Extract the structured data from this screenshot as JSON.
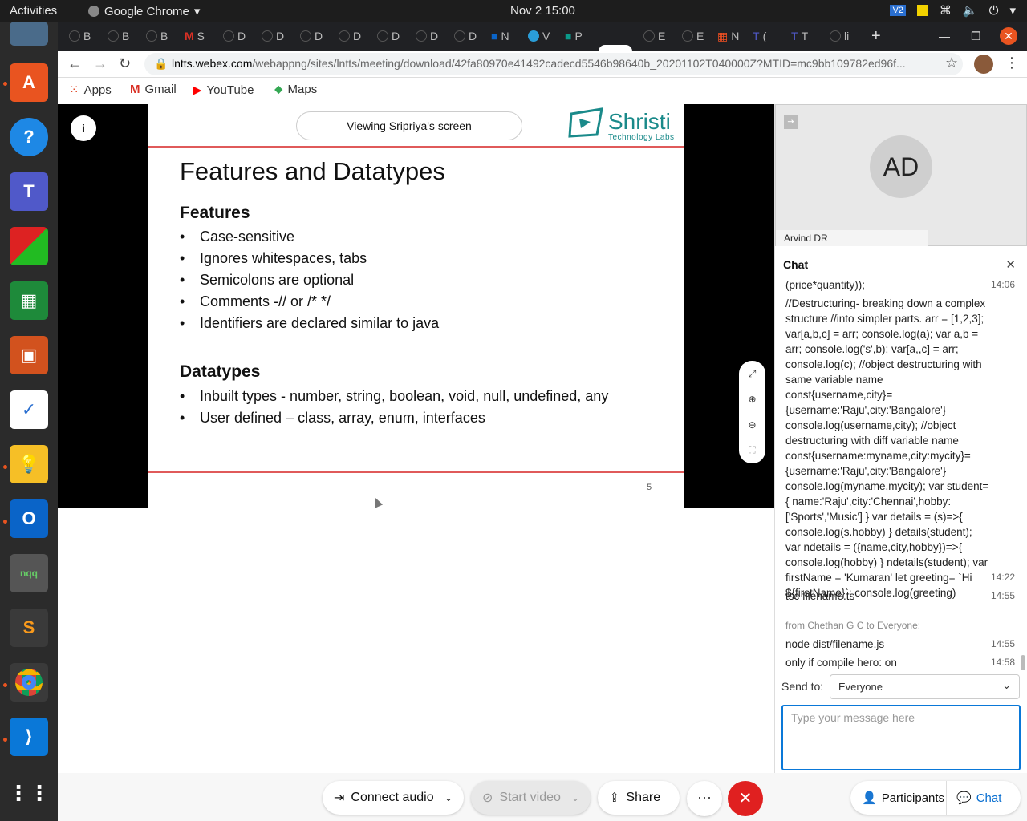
{
  "topbar": {
    "activities": "Activities",
    "app_name": "Google Chrome",
    "clock": "Nov 2  15:00",
    "tray_vd": "V2"
  },
  "dock": {
    "items": [
      "files-icon",
      "software-icon",
      "help-icon",
      "teams-icon",
      "office-icon",
      "calc-icon",
      "impress-icon",
      "todo-icon",
      "keep-icon",
      "outlook-icon",
      "notes-icon",
      "sublime-icon",
      "chrome-icon",
      "vscode-icon",
      "grid-icon"
    ]
  },
  "tabs": [
    {
      "label": "B"
    },
    {
      "label": "B"
    },
    {
      "label": "B"
    },
    {
      "label": "S"
    },
    {
      "label": "D"
    },
    {
      "label": "D"
    },
    {
      "label": "D"
    },
    {
      "label": "D"
    },
    {
      "label": "D"
    },
    {
      "label": "D"
    },
    {
      "label": "D"
    },
    {
      "label": "N"
    },
    {
      "label": "V"
    },
    {
      "label": "P"
    },
    {
      "label": ""
    },
    {
      "label": "E"
    },
    {
      "label": "E"
    },
    {
      "label": "N"
    },
    {
      "label": "("
    },
    {
      "label": "T"
    },
    {
      "label": "li"
    }
  ],
  "address": {
    "host": "lntts.webex.com",
    "path": "/webappng/sites/lntts/meeting/download/42fa80970e41492cadecd5546b98640b_20201102T040000Z?MTID=mc9bb109782ed96f..."
  },
  "bookmarks": {
    "apps": "Apps",
    "gmail": "Gmail",
    "youtube": "YouTube",
    "maps": "Maps"
  },
  "share": {
    "viewing": "Viewing Sripriya's screen"
  },
  "slide": {
    "logo_name": "Shristi",
    "logo_sub": "Technology Labs",
    "title": "Features and Datatypes",
    "features_heading": "Features",
    "features": [
      "Case-sensitive",
      "Ignores whitespaces, tabs",
      "Semicolons are optional",
      "Comments  -// or /* */",
      "Identifiers are declared similar to java"
    ],
    "datatypes_heading": "Datatypes",
    "datatypes": [
      "Inbuilt types - number, string, boolean, void, null, undefined, any",
      "User defined – class, array, enum, interfaces"
    ],
    "bullet": "•",
    "page_number": "5"
  },
  "participant": {
    "initials": "AD",
    "name": "Arvind DR"
  },
  "chat": {
    "title": "Chat",
    "messages": [
      {
        "text": "(price*quantity));",
        "time": "14:06"
      },
      {
        "text": "//Destructuring- breaking down a complex structure //into simpler parts. arr = [1,2,3]; var[a,b,c] = arr; console.log(a); var a,b = arr; console.log('s',b); var[a,,c] = arr; console.log(c); //object destructuring with same variable name const{username,city}={username:'Raju',city:'Bangalore'} console.log(username,city); //object destructuring with diff variable name const{username:myname,city:mycity}={username:'Raju',city:'Bangalore'} console.log(myname,mycity); var student={ name:'Raju',city:'Chennai',hobby:['Sports','Music'] } var details = (s)=>{ console.log(s.hobby) } details(student); var ndetails = ({name,city,hobby})=>{ console.log(hobby) } ndetails(student); var firstName = 'Kumaran' let greeting= `Hi ${firstName}`; console.log(greeting)",
        "time": "14:22"
      },
      {
        "text": "tsc filename.ts",
        "time": "14:55"
      },
      {
        "text": "node dist/filename.js",
        "time": "14:55"
      },
      {
        "text": "only if compile hero: on",
        "time": "14:58"
      }
    ],
    "from_label": "from Chethan G C to Everyone:",
    "send_to_label": "Send to:",
    "send_to_value": "Everyone",
    "input_placeholder": "Type your message here"
  },
  "controls": {
    "connect_audio": "Connect audio",
    "start_video": "Start video",
    "share": "Share",
    "more": "···",
    "participants": "Participants",
    "chat": "Chat"
  },
  "colors": {
    "accent_blue": "#0a78d8",
    "end_red": "#e02020",
    "slide_rule": "#e05a5a",
    "logo_teal": "#1a8a8a"
  }
}
